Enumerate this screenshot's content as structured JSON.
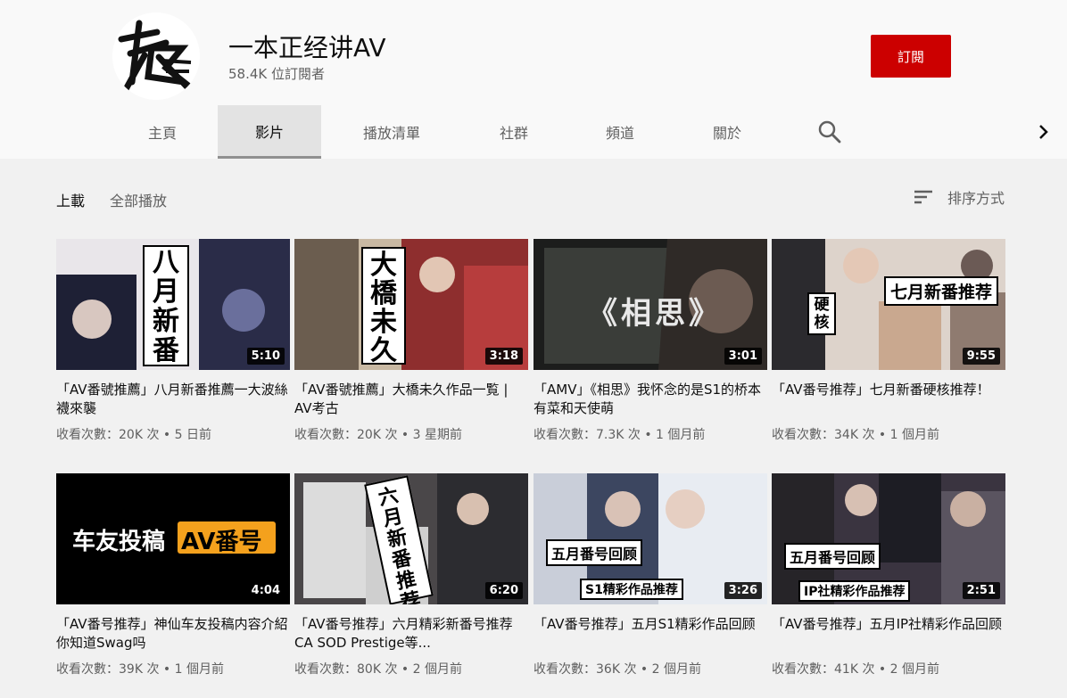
{
  "channel": {
    "name": "一本正经讲AV",
    "subscribers": "58.4K 位訂閱者",
    "subscribe_label": "訂閱"
  },
  "tabs": [
    "主頁",
    "影片",
    "播放清單",
    "社群",
    "頻道",
    "關於"
  ],
  "active_tab": "影片",
  "toolbar": {
    "uploads": "上載",
    "play_all": "全部播放",
    "sort": "排序方式"
  },
  "videos": [
    {
      "title": "「AV番號推薦」八月新番推薦一大波絲襪來襲",
      "duration": "5:10",
      "meta": "收看次數：20K 次 • 5 日前",
      "overlay": "八月新番",
      "thumb_color": "#2a2c38"
    },
    {
      "title": "「AV番號推薦」大橋未久作品一覧 | AV考古",
      "duration": "3:18",
      "meta": "收看次數：20K 次 • 3 星期前",
      "overlay": "大橋未久",
      "thumb_color": "#5b2a2a"
    },
    {
      "title": "「AMV」《相思》我怀念的是S1的桥本有菜和天使萌",
      "duration": "3:01",
      "meta": "收看次數：7.3K 次 • 1 個月前",
      "overlay": "《相思》",
      "thumb_color": "#1e1f1e"
    },
    {
      "title": "「AV番号推荐」七月新番硬核推荐！",
      "duration": "9:55",
      "meta": "收看次數：34K 次 • 1 個月前",
      "overlay": "七月新番推荐",
      "overlay2": "硬核",
      "thumb_color": "#b9a99b"
    },
    {
      "title": "「AV番号推荐」神仙车友投稿内容介紹 你知道Swag吗",
      "duration": "4:04",
      "meta": "收看次數：39K 次 • 1 個月前",
      "overlay": "车友投稿",
      "overlay2": "AV番号",
      "thumb_color": "#000000"
    },
    {
      "title": "「AV番号推荐」六月精彩新番号推荐 CA SOD Prestige等...",
      "duration": "6:20",
      "meta": "收看次數：80K 次 • 2 個月前",
      "overlay": "六月新番推荐",
      "thumb_color": "#3c3a3c"
    },
    {
      "title": "「AV番号推荐」五月S1精彩作品回顾",
      "duration": "3:26",
      "meta": "收看次數：36K 次 • 2 個月前",
      "overlay": "五月番号回顾",
      "overlay2": "S1精彩作品推荐",
      "thumb_color": "#c8cdd8"
    },
    {
      "title": "「AV番号推荐」五月IP社精彩作品回顾",
      "duration": "2:51",
      "meta": "收看次數：41K 次 • 2 個月前",
      "overlay": "五月番号回顾",
      "overlay2": "IP社精彩作品推荐",
      "thumb_color": "#3a3440"
    }
  ]
}
